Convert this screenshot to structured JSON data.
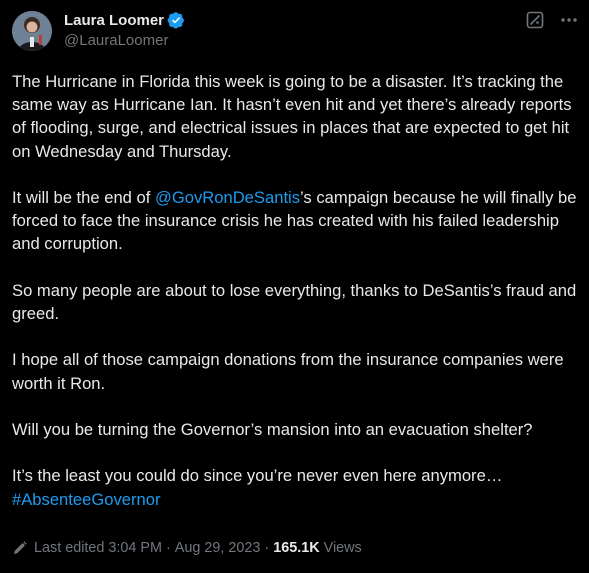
{
  "author": {
    "display_name": "Laura Loomer",
    "handle": "@LauraLoomer",
    "verified": true,
    "avatar_icon": "profile-photo"
  },
  "icons": {
    "verified": "verified-badge-icon",
    "grok": "grok-icon",
    "more": "more-options-icon",
    "edit": "edit-pencil-icon"
  },
  "colors": {
    "background": "#000000",
    "text": "#e7e9ea",
    "muted": "#71767b",
    "link": "#1d9bf0"
  },
  "tweet": {
    "p1": "The Hurricane in Florida this week is going to be a disaster. It’s tracking the same way as Hurricane Ian. It hasn’t even hit and yet there’s already reports of flooding, surge, and electrical issues in places that are expected to get hit on Wednesday and Thursday.",
    "p2_before": "It will be the end of ",
    "p2_mention": "@GovRonDeSantis",
    "p2_after": "’s campaign because he will finally be forced to face the insurance crisis he has created with his failed leadership and corruption.",
    "p3": "So many people are about to lose everything, thanks to DeSantis’s fraud and greed.",
    "p4": "I hope all of those campaign donations from the insurance companies were worth it Ron.",
    "p5": "Will you be turning the Governor’s mansion into an evacuation shelter?",
    "p6": "It’s the least you could do since you’re never even here anymore…",
    "hashtag": "#AbsenteeGovernor"
  },
  "meta": {
    "edited_label": "Last edited 3:04 PM",
    "separator": "·",
    "date": "Aug 29, 2023",
    "views_count": "165.1K",
    "views_label": "Views"
  }
}
